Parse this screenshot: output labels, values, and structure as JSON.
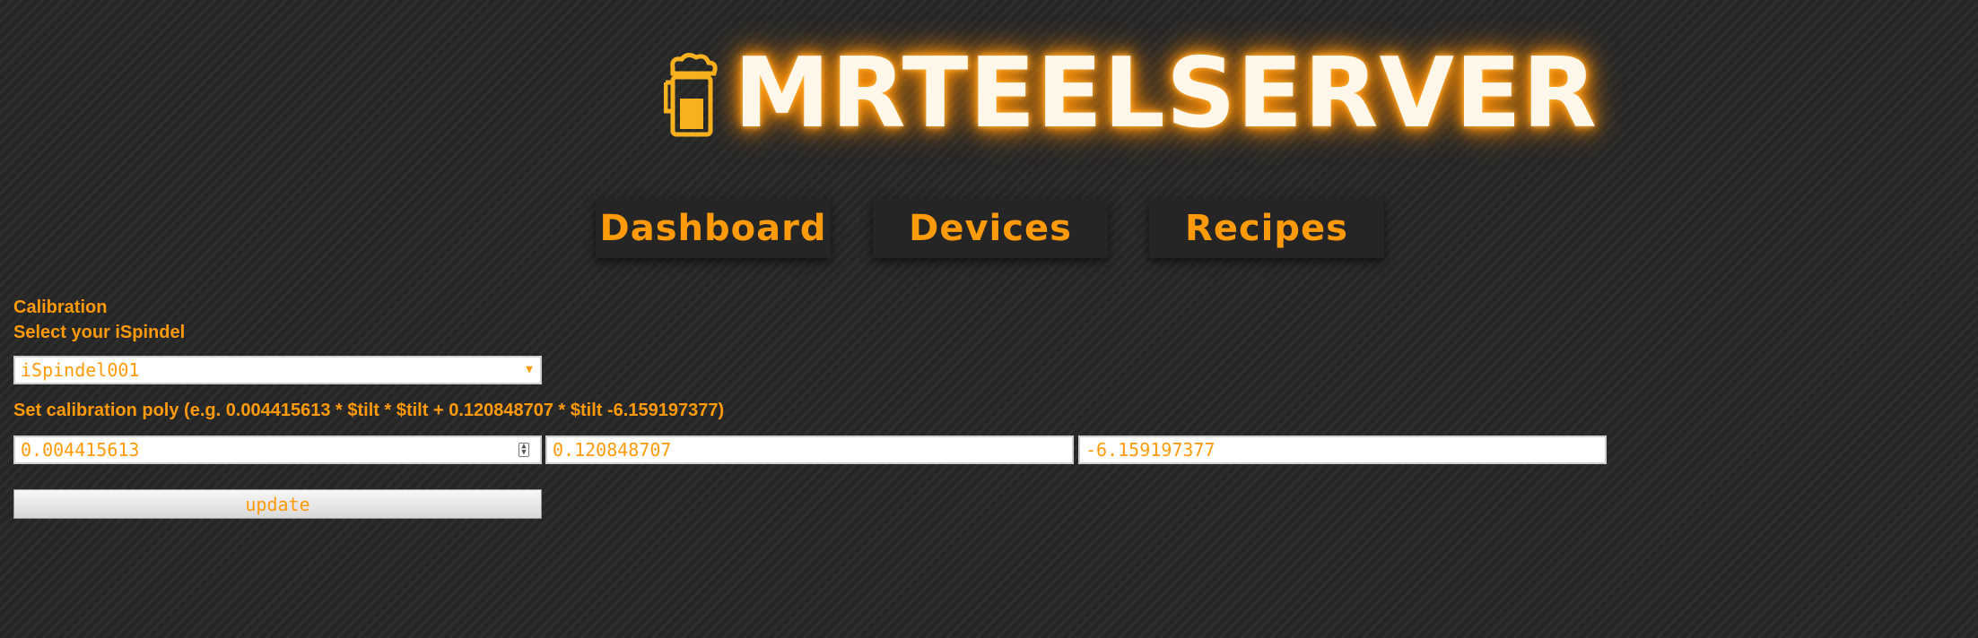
{
  "header": {
    "brand": "MRTEELSERVER",
    "logo_icon": "beer-mug-icon"
  },
  "nav": {
    "items": [
      {
        "label": "Dashboard"
      },
      {
        "label": "Devices"
      },
      {
        "label": "Recipes"
      }
    ]
  },
  "calibration": {
    "title": "Calibration",
    "select_label": "Select your iSpindel",
    "selected_device": "iSpindel001",
    "poly_label": "Set calibration poly (e.g. 0.004415613 * $tilt * $tilt + 0.120848707 * $tilt -6.159197377)",
    "coef_a": "0.004415613",
    "coef_b": "0.120848707",
    "coef_c": "-6.159197377",
    "update_label": "update"
  },
  "colors": {
    "accent": "#ff9a0a",
    "background": "#262626",
    "glow": "#ff8a00"
  }
}
